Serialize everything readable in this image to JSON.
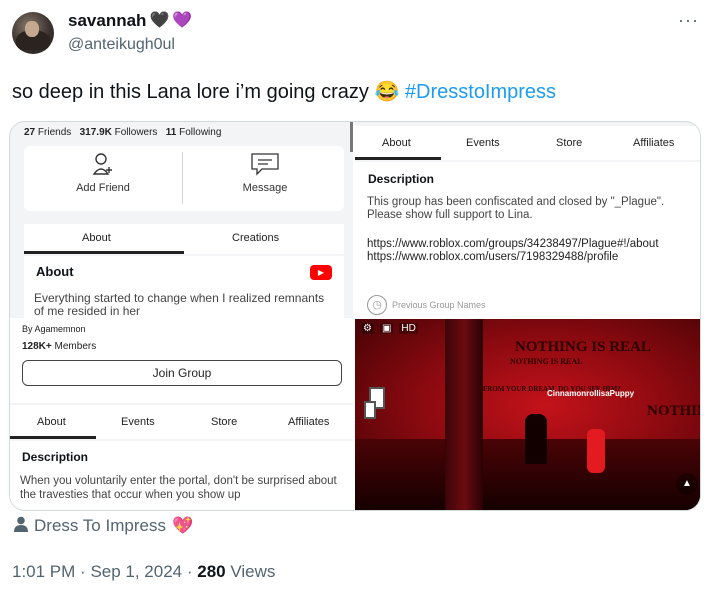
{
  "author": {
    "display_name": "savannah",
    "heart_1": "🖤",
    "heart_2": "💜",
    "handle": "@anteikugh0ul",
    "more": "···"
  },
  "tweet": {
    "text": "so deep in this Lana lore i’m going crazy",
    "emoji": "😂",
    "hashtag": "#DresstoImpress"
  },
  "screenshot_profile": {
    "friends_count": "27",
    "friends_label": "Friends",
    "followers_count": "317.9K",
    "followers_label": "Followers",
    "following_count": "11",
    "following_label": "Following",
    "add_friend": "Add Friend",
    "message": "Message",
    "tab_about": "About",
    "tab_creations": "Creations",
    "about_heading": "About",
    "youtube": "▶",
    "about_text": "Everything started to change when I realized remnants of me resided in her"
  },
  "screenshot_group_desc": {
    "tabs": [
      "About",
      "Events",
      "Store",
      "Affiliates"
    ],
    "heading": "Description",
    "text": "This group has been confiscated and closed by \"_Plague\". Please show full support to Lina.",
    "link_1": "https://www.roblox.com/groups/34238497/Plague#!/about",
    "link_2": "https://www.roblox.com/users/7198329488/profile",
    "previous_names": "Previous Group Names"
  },
  "screenshot_group": {
    "by": "By Agamemnon",
    "members_count": "128K+",
    "members_label": "Members",
    "join": "Join Group",
    "tabs": [
      "About",
      "Events",
      "Store",
      "Affiliates"
    ],
    "heading": "Description",
    "text": "When you voluntarily enter the portal, don't be surprised about the travesties that occur when you show up"
  },
  "screenshot_game": {
    "hud_hd": "HD",
    "wall_text_1": "NOTHING IS REAL",
    "wall_text_2": "NOTHING IS REAL",
    "wall_text_3": "FROM YOUR DREAM, DO YOU SEE HIM?",
    "wall_text_4": "NOTHING",
    "player_name": "CinnamonrollisaPuppy"
  },
  "tag": {
    "label": "Dress To Impress",
    "emoji": "💖"
  },
  "meta": {
    "time": "1:01 PM",
    "date": "Sep 1, 2024",
    "views_count": "280",
    "views_label": "Views"
  }
}
